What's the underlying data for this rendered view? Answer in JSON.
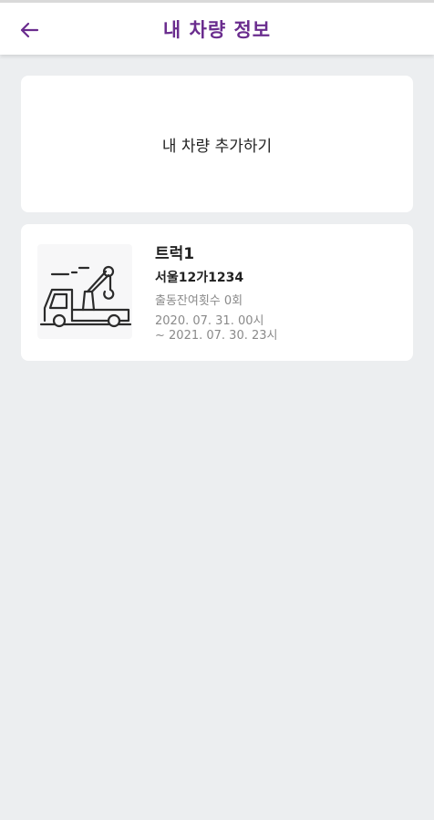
{
  "header": {
    "title": "내 차량 정보",
    "back_icon": "arrow-left-icon",
    "accent_color": "#6a2c8e"
  },
  "add_vehicle": {
    "label": "내 차량 추가하기"
  },
  "vehicles": [
    {
      "name": "트럭1",
      "plate": "서울12가1234",
      "remaining_dispatch": "출동잔여횟수 0회",
      "period_start": "2020. 07. 31. 00시",
      "period_end": "~ 2021. 07. 30. 23시",
      "icon": "tow-truck-icon"
    }
  ]
}
